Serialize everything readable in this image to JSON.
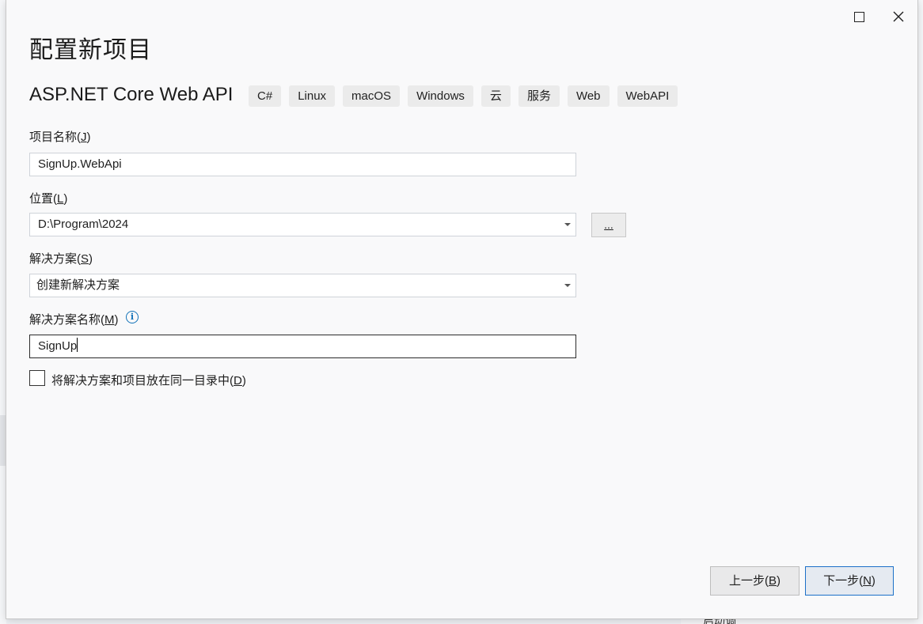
{
  "dialog": {
    "title": "配置新项目",
    "template_name": "ASP.NET Core Web API",
    "tags": [
      "C#",
      "Linux",
      "macOS",
      "Windows",
      "云",
      "服务",
      "Web",
      "WebAPI"
    ]
  },
  "form": {
    "project_name": {
      "label": "项目名称",
      "hotkey": "J",
      "value": "SignUp.WebApi"
    },
    "location": {
      "label": "位置",
      "hotkey": "L",
      "value": "D:\\Program\\2024",
      "browse_label": "..."
    },
    "solution": {
      "label": "解决方案",
      "hotkey": "S",
      "value": "创建新解决方案"
    },
    "solution_name": {
      "label": "解决方案名称",
      "hotkey": "M",
      "value": "SignUp"
    },
    "same_dir": {
      "label": "将解决方案和项目放在同一目录中",
      "hotkey": "D",
      "checked": false
    }
  },
  "buttons": {
    "back": {
      "label": "上一步",
      "hotkey": "B"
    },
    "next": {
      "label": "下一步",
      "hotkey": "N"
    }
  },
  "background": {
    "bottom_text": "启动调"
  },
  "icons": {
    "maximize": "maximize-icon",
    "close": "close-icon",
    "info": "info-icon",
    "dropdown": "chevron-down-icon"
  }
}
